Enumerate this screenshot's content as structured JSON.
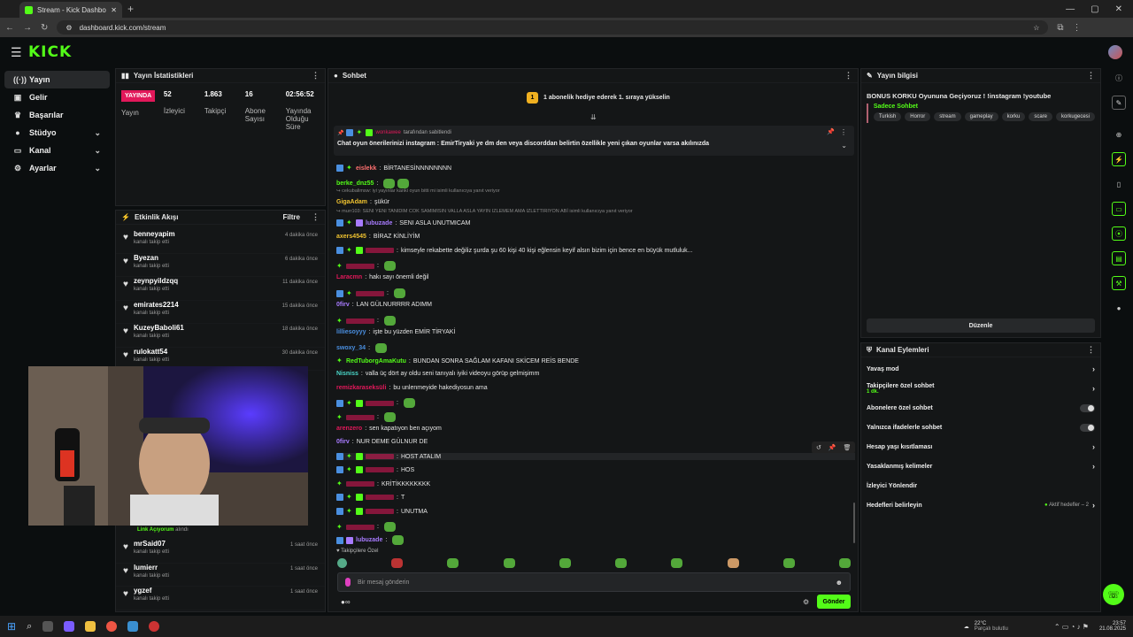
{
  "browser": {
    "tab_title": "Stream - Kick Dashboard",
    "url": "dashboard.kick.com/stream"
  },
  "header": {
    "logo": "KICK"
  },
  "nav": {
    "items": [
      {
        "label": "Yayın",
        "icon": "broadcast-icon"
      },
      {
        "label": "Gelir",
        "icon": "income-icon"
      },
      {
        "label": "Başarılar",
        "icon": "trophy-icon"
      },
      {
        "label": "Stüdyo",
        "icon": "studio-icon"
      },
      {
        "label": "Kanal",
        "icon": "channel-icon"
      },
      {
        "label": "Ayarlar",
        "icon": "gear-icon"
      }
    ]
  },
  "stats": {
    "title": "Yayın İstatistikleri",
    "live_badge": "YAYINDA",
    "live_label": "Yayın",
    "viewers_value": "52",
    "viewers_label": "İzleyici",
    "followers_value": "1.863",
    "followers_label": "Takipçi",
    "subs_value": "16",
    "subs_label": "Abone Sayısı",
    "duration_value": "02:56:52",
    "duration_label": "Yayında Olduğu Süre"
  },
  "activity": {
    "title": "Etkinlik Akışı",
    "filter": "Filtre",
    "items": [
      {
        "name": "benneyapim",
        "sub": "kanalı takip etti",
        "time": "4 dakika önce"
      },
      {
        "name": "Byezan",
        "sub": "kanalı takip etti",
        "time": "6 dakika önce"
      },
      {
        "name": "zeynpyildzqq",
        "sub": "kanalı takip etti",
        "time": "11 dakika önce"
      },
      {
        "name": "emirates2214",
        "sub": "kanalı takip etti",
        "time": "15 dakika önce"
      },
      {
        "name": "KuzeyBaboli61",
        "sub": "kanalı takip etti",
        "time": "18 dakika önce"
      },
      {
        "name": "rulokatt54",
        "sub": "kanalı takip etti",
        "time": "30 dakika önce"
      }
    ],
    "redeem_name": "Link Açıyorum",
    "redeem_sub": "alındı",
    "items_bottom": [
      {
        "name": "mrSaid07",
        "sub": "kanalı takip etti",
        "time": "1 saat önce"
      },
      {
        "name": "lumierr",
        "sub": "kanalı takip etti",
        "time": "1 saat önce"
      },
      {
        "name": "ygzef",
        "sub": "kanalı takip etti",
        "time": "1 saat önce"
      }
    ]
  },
  "chat": {
    "title": "Sohbet",
    "goal_count": "1",
    "goal_text": "1 abonelik hediye ederek 1. sıraya yükselin",
    "pinned_by": "tarafından sabitlendi",
    "pinned_text": "Chat oyun önerilerinizi instagram : EmirTiryaki ye dm den veya discorddan belirtin özellikle yeni çıkan oyunlar varsa akılınızda",
    "messages": [
      {
        "user": "eislekk",
        "text": "BİRTANESİNNNNNNNN",
        "color": "#ff7070"
      },
      {
        "user": "berke_dnz55",
        "text": "",
        "color": "#53fc18"
      },
      {
        "user": "GigaAdam",
        "text": "şükür",
        "color": "#f0c330"
      },
      {
        "user": "lubuzade",
        "text": "SENI ASLA UNUTMICAM",
        "color": "#a87bff"
      },
      {
        "user": "axers4545",
        "text": "BİRAZ KİNLİYİM",
        "color": "#f0c330"
      },
      {
        "user": "",
        "text": "kimseyle rekabette değiliz şurda şu 60 kişi 40 kişi eğlensin keyif alsın bizim için bence en büyük mutluluk...",
        "color": "#e2185a"
      },
      {
        "user": "",
        "text": "",
        "color": "#e2185a"
      },
      {
        "user": "Laracmn",
        "text": "hakı sayı önemli değil",
        "color": "#e2185a"
      },
      {
        "user": "",
        "text": "",
        "color": "#e2185a"
      },
      {
        "user": "0firv",
        "text": "LAN GÜLNURRRR ADIMM",
        "color": "#a87bff"
      },
      {
        "user": "",
        "text": "",
        "color": "#e2185a"
      },
      {
        "user": "lilliesoyyy",
        "text": "işte bu yüzden EMİR TİRYAKİ",
        "color": "#4a8fe0"
      },
      {
        "user": "swoxy_34",
        "text": "",
        "color": "#4a8fe0"
      },
      {
        "user": "RedTuborgAmaKutu",
        "text": "BUNDAN SONRA SAĞLAM KAFANI SKİCEM REİS BENDE",
        "color": "#53fc18"
      },
      {
        "user": "Nisniss",
        "text": "valla üç dört ay oldu seni tanıyalı iyiki videoyu görüp gelmişimm",
        "color": "#4ad6c8"
      },
      {
        "user": "remizkaraseksüli",
        "text": "bu unlenmeyide hakediyosun ama",
        "color": "#e2185a"
      },
      {
        "user": "",
        "text": "",
        "color": "#e2185a"
      },
      {
        "user": "",
        "text": "",
        "color": "#e2185a"
      },
      {
        "user": "arenzero",
        "text": "sen kapatıyon ben açıyom",
        "color": "#e2185a"
      },
      {
        "user": "0firv",
        "text": "NUR DEME GÜLNUR DE",
        "color": "#a87bff"
      },
      {
        "user": "",
        "text": "HOST ATALIM",
        "color": "#e2185a"
      },
      {
        "user": "",
        "text": "HOS",
        "color": "#e2185a"
      },
      {
        "user": "",
        "text": "KRİTİKKKKKKKK",
        "color": "#e2185a"
      },
      {
        "user": "",
        "text": "T",
        "color": "#e2185a"
      },
      {
        "user": "",
        "text": "UNUTMA",
        "color": "#e2185a"
      },
      {
        "user": "",
        "text": "",
        "color": "#e2185a"
      },
      {
        "user": "lubuzade",
        "text": "",
        "color": "#a87bff"
      }
    ],
    "replies": [
      "cekubalimsw: iyi yayınlar kanki oyun bitti mi isimli kullanıcıya yanıt veriyor",
      "murr103: SENI YENI TANIDIM COK SAMIMISIN VALLA ASLA YAYIN IZLEMEM AMA IZLETTIRIYON ABİ isimli kullanıcıya yanıt veriyor"
    ],
    "followers_only": "Takipçilere Özel",
    "input_placeholder": "Bir mesaj gönderin",
    "send": "Gönder"
  },
  "stream_info": {
    "title": "Yayın bilgisi",
    "stream_title": "BONUS KORKU Oyununa Geçiyoruz ! !instagram !youtube",
    "category": "Sadece Sohbet",
    "tags": [
      "Turkish",
      "Horror",
      "stream",
      "gameplay",
      "korku",
      "scare",
      "korkugecesi"
    ],
    "edit": "Düzenle"
  },
  "channel_actions": {
    "title": "Kanal Eylemleri",
    "slow_mode": "Yavaş mod",
    "followers_chat": "Takipçilere özel sohbet",
    "followers_chat_sub": "1 dk.",
    "subs_chat": "Abonelere özel sohbet",
    "emote_chat": "Yalnızca ifadelerle sohbet",
    "account_age": "Hesap yaşı kısıtlaması",
    "banned_words": "Yasaklanmış kelimeler",
    "viewer_redirect": "İzleyici Yönlendir",
    "set_goals": "Hedefleri belirleyin",
    "goals_status": "Aktif hedefler – 2"
  },
  "taskbar": {
    "temp": "22°C",
    "weather": "Parçalı bulutlu",
    "time": "23:57",
    "date": "21.08.2025"
  },
  "colors": {
    "brand": "#53fc18",
    "live": "#e2185a"
  }
}
